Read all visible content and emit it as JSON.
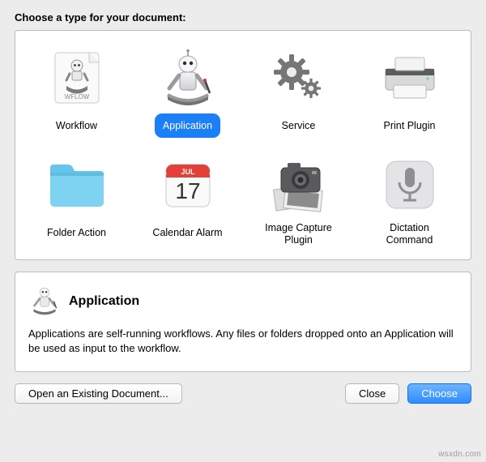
{
  "header": "Choose a type for your document:",
  "types": [
    {
      "id": "workflow",
      "label": "Workflow"
    },
    {
      "id": "application",
      "label": "Application"
    },
    {
      "id": "service",
      "label": "Service"
    },
    {
      "id": "print-plugin",
      "label": "Print Plugin"
    },
    {
      "id": "folder-action",
      "label": "Folder Action"
    },
    {
      "id": "calendar-alarm",
      "label": "Calendar Alarm"
    },
    {
      "id": "image-capture-plugin",
      "label": "Image Capture\nPlugin"
    },
    {
      "id": "dictation-command",
      "label": "Dictation\nCommand"
    }
  ],
  "selected_index": 1,
  "description": {
    "title": "Application",
    "body": "Applications are self-running workflows. Any files or folders dropped onto an Application will be used as input to the workflow."
  },
  "buttons": {
    "open_existing": "Open an Existing Document...",
    "close": "Close",
    "choose": "Choose"
  },
  "workflow_doc_label": "WFLOW",
  "calendar_month": "JUL",
  "calendar_day": "17",
  "watermark": "wsxdn.com"
}
